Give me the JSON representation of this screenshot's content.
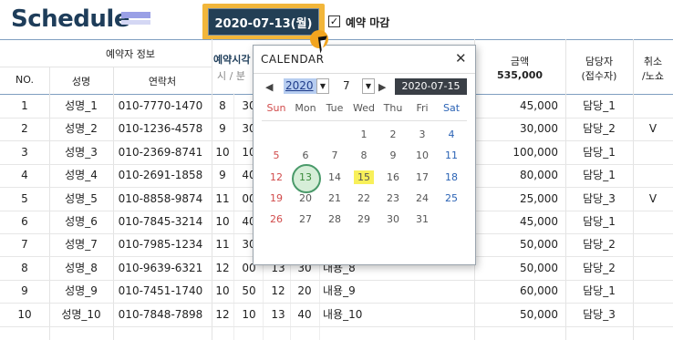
{
  "header": {
    "title": "Schedule",
    "date_button": "2020-07-13(월)",
    "closed_checkbox_label": "예약 마감",
    "closed_checked": true
  },
  "table_header": {
    "group_reserver": "예약자 정보",
    "col_no": "NO.",
    "col_name": "성명",
    "col_phone": "연락처",
    "group_time_visible": "예약시각",
    "sub_time_visible": "시 / 분",
    "col_amount": "금액",
    "amount_total": "535,000",
    "col_staff_line1": "담당자",
    "col_staff_line2": "(접수자)",
    "col_cancel_line1": "취소",
    "col_cancel_line2": "/노쇼"
  },
  "rows": [
    {
      "no": "1",
      "name": "성명_1",
      "phone": "010-7770-1470",
      "sh": "8",
      "sm": "30",
      "eh": "",
      "em": "",
      "content": "",
      "amount": "45,000",
      "staff": "담당_1",
      "cancel": ""
    },
    {
      "no": "2",
      "name": "성명_2",
      "phone": "010-1236-4578",
      "sh": "9",
      "sm": "30",
      "eh": "",
      "em": "",
      "content": "",
      "amount": "30,000",
      "staff": "담당_2",
      "cancel": "V"
    },
    {
      "no": "3",
      "name": "성명_3",
      "phone": "010-2369-8741",
      "sh": "10",
      "sm": "10",
      "eh": "",
      "em": "",
      "content": "",
      "amount": "100,000",
      "staff": "담당_1",
      "cancel": ""
    },
    {
      "no": "4",
      "name": "성명_4",
      "phone": "010-2691-1858",
      "sh": "9",
      "sm": "40",
      "eh": "",
      "em": "",
      "content": "",
      "amount": "80,000",
      "staff": "담당_1",
      "cancel": ""
    },
    {
      "no": "5",
      "name": "성명_5",
      "phone": "010-8858-9874",
      "sh": "11",
      "sm": "00",
      "eh": "",
      "em": "",
      "content": "",
      "amount": "25,000",
      "staff": "담당_3",
      "cancel": "V"
    },
    {
      "no": "6",
      "name": "성명_6",
      "phone": "010-7845-3214",
      "sh": "10",
      "sm": "40",
      "eh": "",
      "em": "",
      "content": "",
      "amount": "45,000",
      "staff": "담당_1",
      "cancel": ""
    },
    {
      "no": "7",
      "name": "성명_7",
      "phone": "010-7985-1234",
      "sh": "11",
      "sm": "30",
      "eh": "",
      "em": "",
      "content": "",
      "amount": "50,000",
      "staff": "담당_2",
      "cancel": ""
    },
    {
      "no": "8",
      "name": "성명_8",
      "phone": "010-9639-6321",
      "sh": "12",
      "sm": "00",
      "eh": "13",
      "em": "30",
      "content": "내용_8",
      "amount": "50,000",
      "staff": "담당_2",
      "cancel": ""
    },
    {
      "no": "9",
      "name": "성명_9",
      "phone": "010-7451-1740",
      "sh": "10",
      "sm": "50",
      "eh": "12",
      "em": "20",
      "content": "내용_9",
      "amount": "60,000",
      "staff": "담당_1",
      "cancel": ""
    },
    {
      "no": "10",
      "name": "성명_10",
      "phone": "010-7848-7898",
      "sh": "12",
      "sm": "10",
      "eh": "13",
      "em": "40",
      "content": "내용_10",
      "amount": "50,000",
      "staff": "담당_3",
      "cancel": ""
    }
  ],
  "calendar": {
    "title": "CALENDAR",
    "close": "✕",
    "prev": "◀",
    "next": "▶",
    "year": "2020",
    "month": "7",
    "dropdown": "▼",
    "today_button": "2020-07-15",
    "weekdays": [
      "Sun",
      "Mon",
      "Tue",
      "Wed",
      "Thu",
      "Fri",
      "Sat"
    ],
    "weeks": [
      [
        "",
        "",
        "",
        "1",
        "2",
        "3",
        "4"
      ],
      [
        "5",
        "6",
        "7",
        "8",
        "9",
        "10",
        "11"
      ],
      [
        "12",
        "13",
        "14",
        "15",
        "16",
        "17",
        "18"
      ],
      [
        "19",
        "20",
        "21",
        "22",
        "23",
        "24",
        "25"
      ],
      [
        "26",
        "27",
        "28",
        "29",
        "30",
        "31",
        ""
      ]
    ],
    "selected_day": "13",
    "highlighted_day": "15"
  },
  "colors": {
    "title": "#1e3d5a",
    "date_button_bg": "#233f55",
    "date_button_frame": "#f2b63a",
    "sunday": "#d14b4b",
    "saturday": "#2b63b5",
    "highlight": "#f8f05a",
    "selected_ring": "#4a9a6a"
  }
}
